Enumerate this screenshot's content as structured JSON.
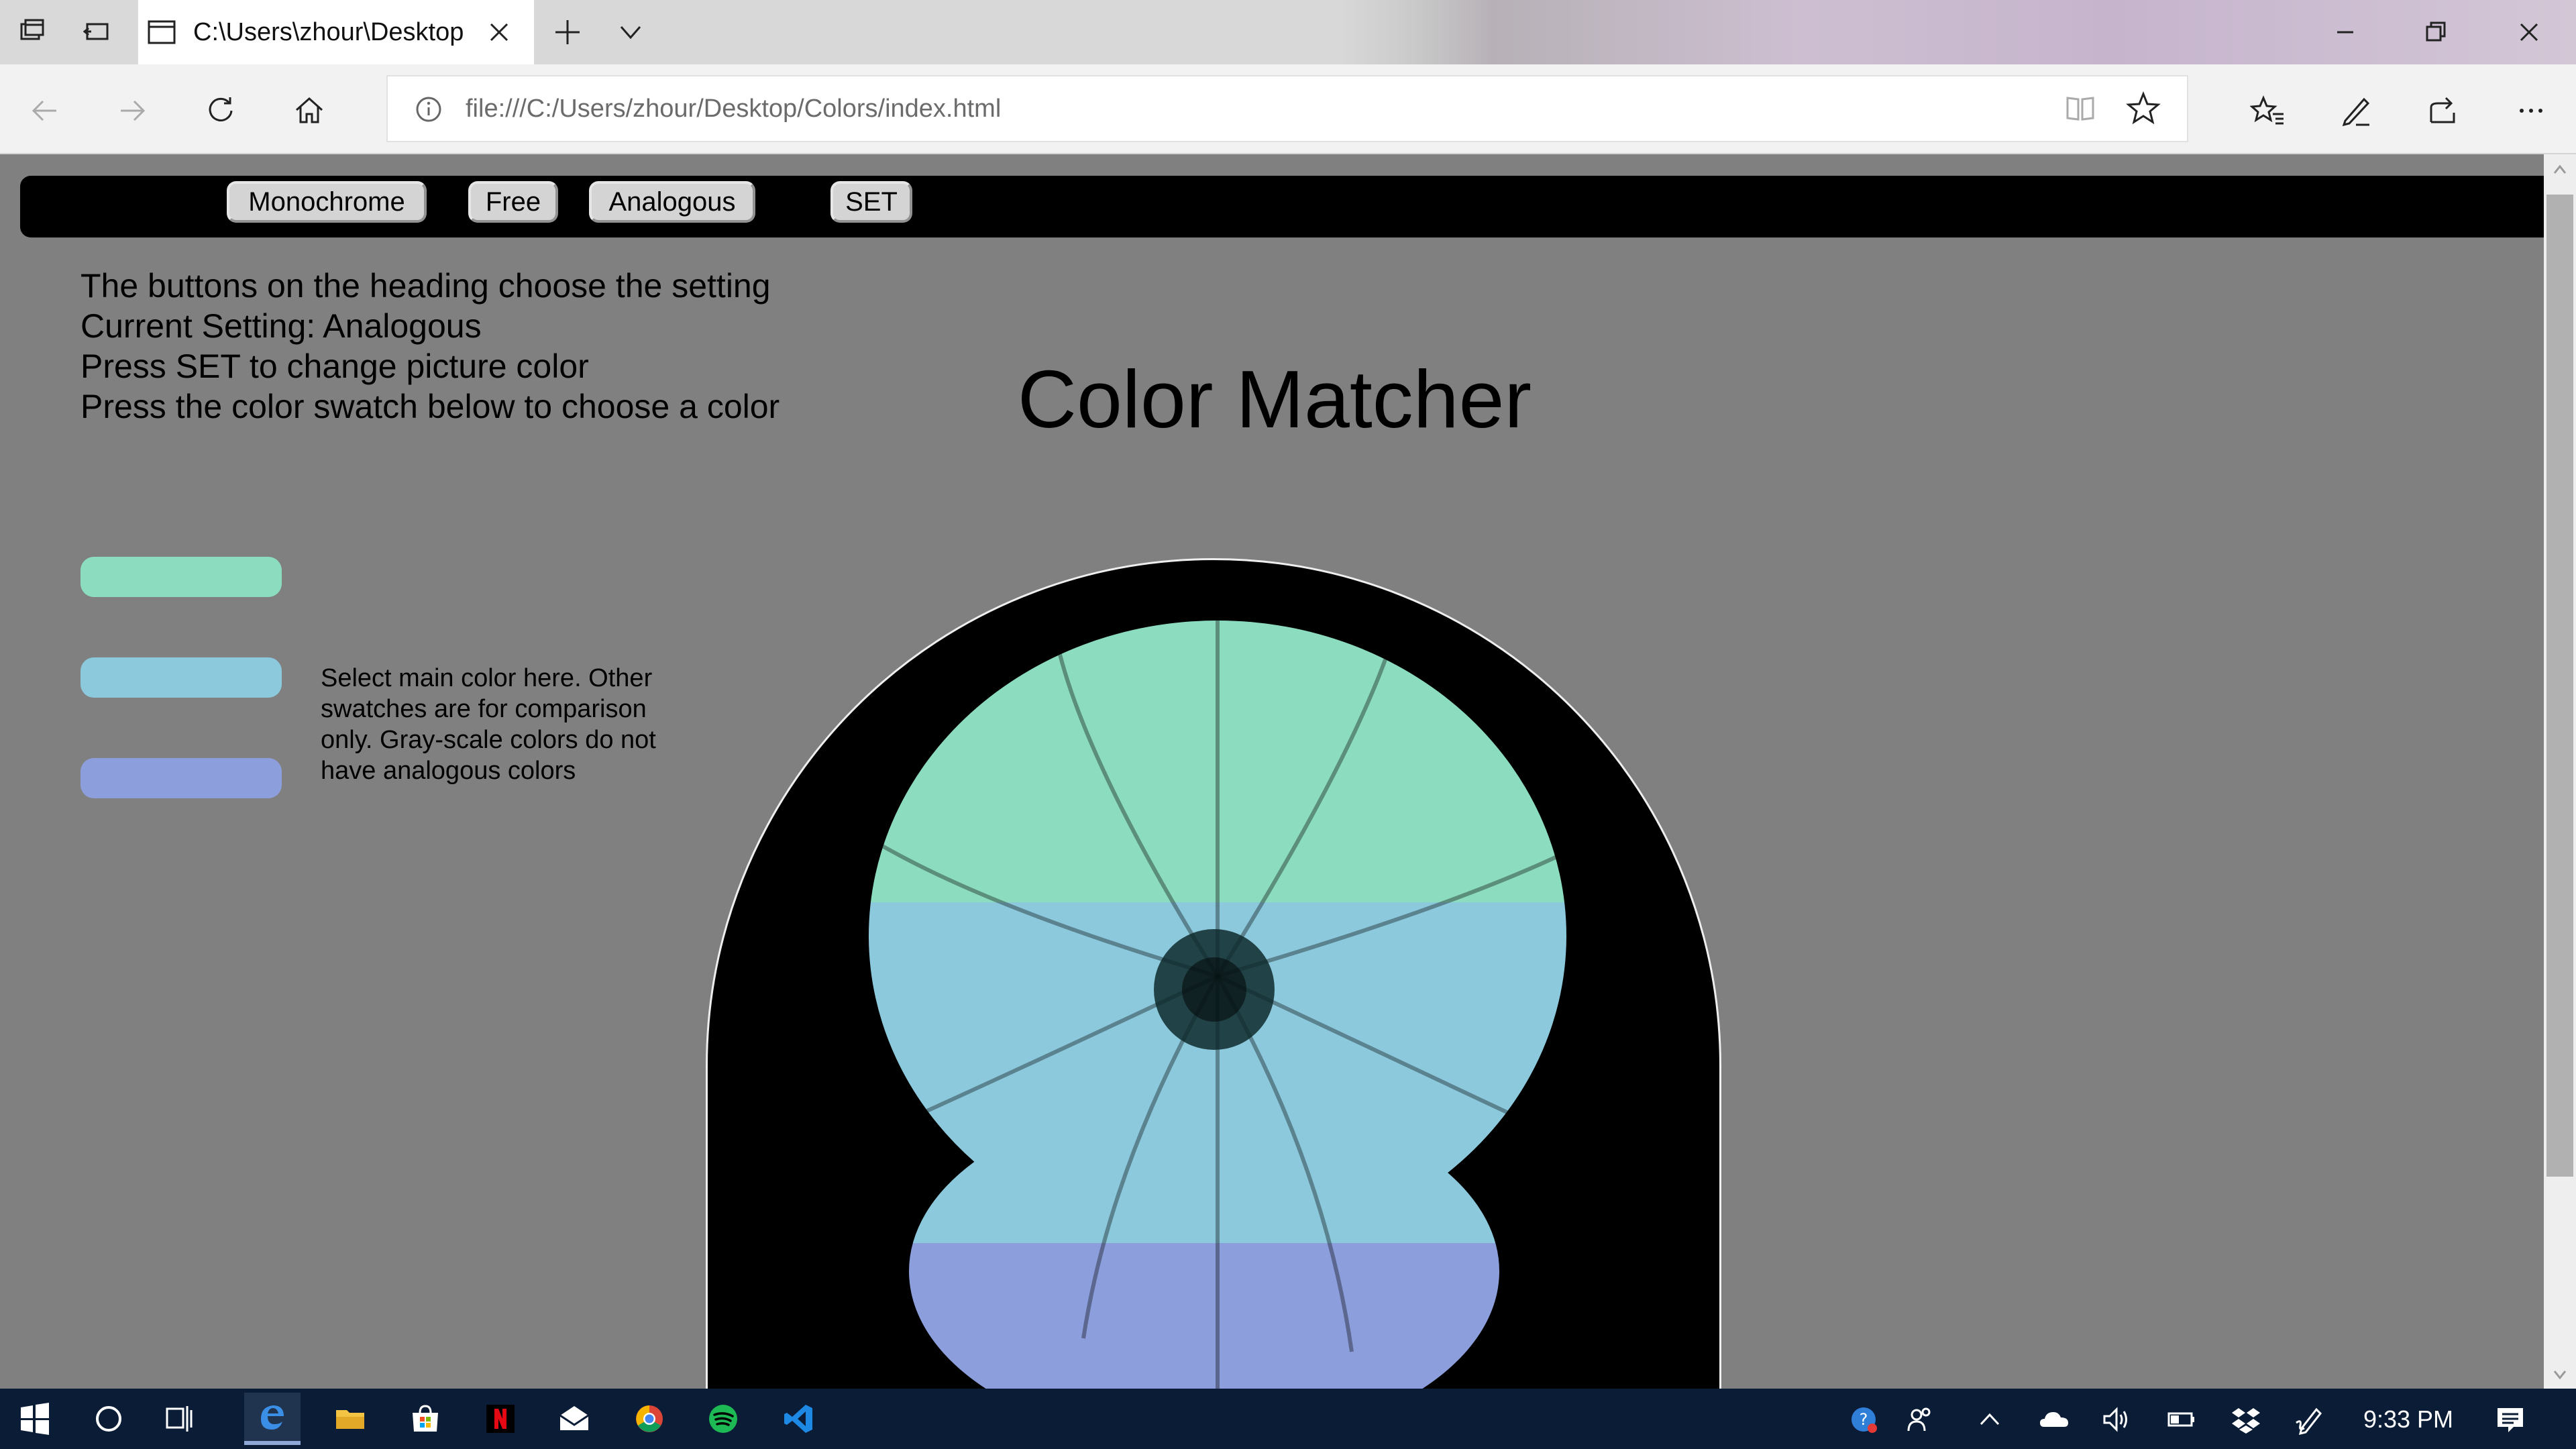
{
  "browser": {
    "tab": {
      "title": "C:\\Users\\zhour\\Desktop"
    },
    "address_bar": {
      "url": "file:///C:/Users/zhour/Desktop/Colors/index.html"
    }
  },
  "page": {
    "heading_buttons": [
      {
        "label": "Monochrome"
      },
      {
        "label": "Free"
      },
      {
        "label": "Analogous"
      },
      {
        "label": "SET"
      }
    ],
    "instructions": [
      "The buttons on the heading choose the setting",
      "Current Setting: Analogous",
      "Press SET to change picture color",
      "Press the color swatch below to choose a color"
    ],
    "title": "Color Matcher",
    "swatches": [
      {
        "color": "#8cdcbf"
      },
      {
        "color": "#8cc9dc"
      },
      {
        "color": "#8c9fdc"
      }
    ],
    "swatch_note": "Select main color here. Other swatches are for comparison only. Gray-scale colors do not have analogous colors",
    "image_tint_bands": [
      "#8cdcbf",
      "#8cc9dc",
      "#8c9fdc"
    ]
  },
  "taskbar": {
    "apps": [
      "start-icon",
      "cortana-icon",
      "task-view-icon",
      "edge-icon",
      "file-explorer-icon",
      "store-icon",
      "netflix-icon",
      "mail-icon",
      "chrome-icon",
      "spotify-icon",
      "vscode-icon"
    ],
    "clock": "9:33 PM"
  },
  "colors": {
    "page_background": "#808080",
    "heading_bar": "#000000",
    "taskbar": "#0b1d36"
  }
}
